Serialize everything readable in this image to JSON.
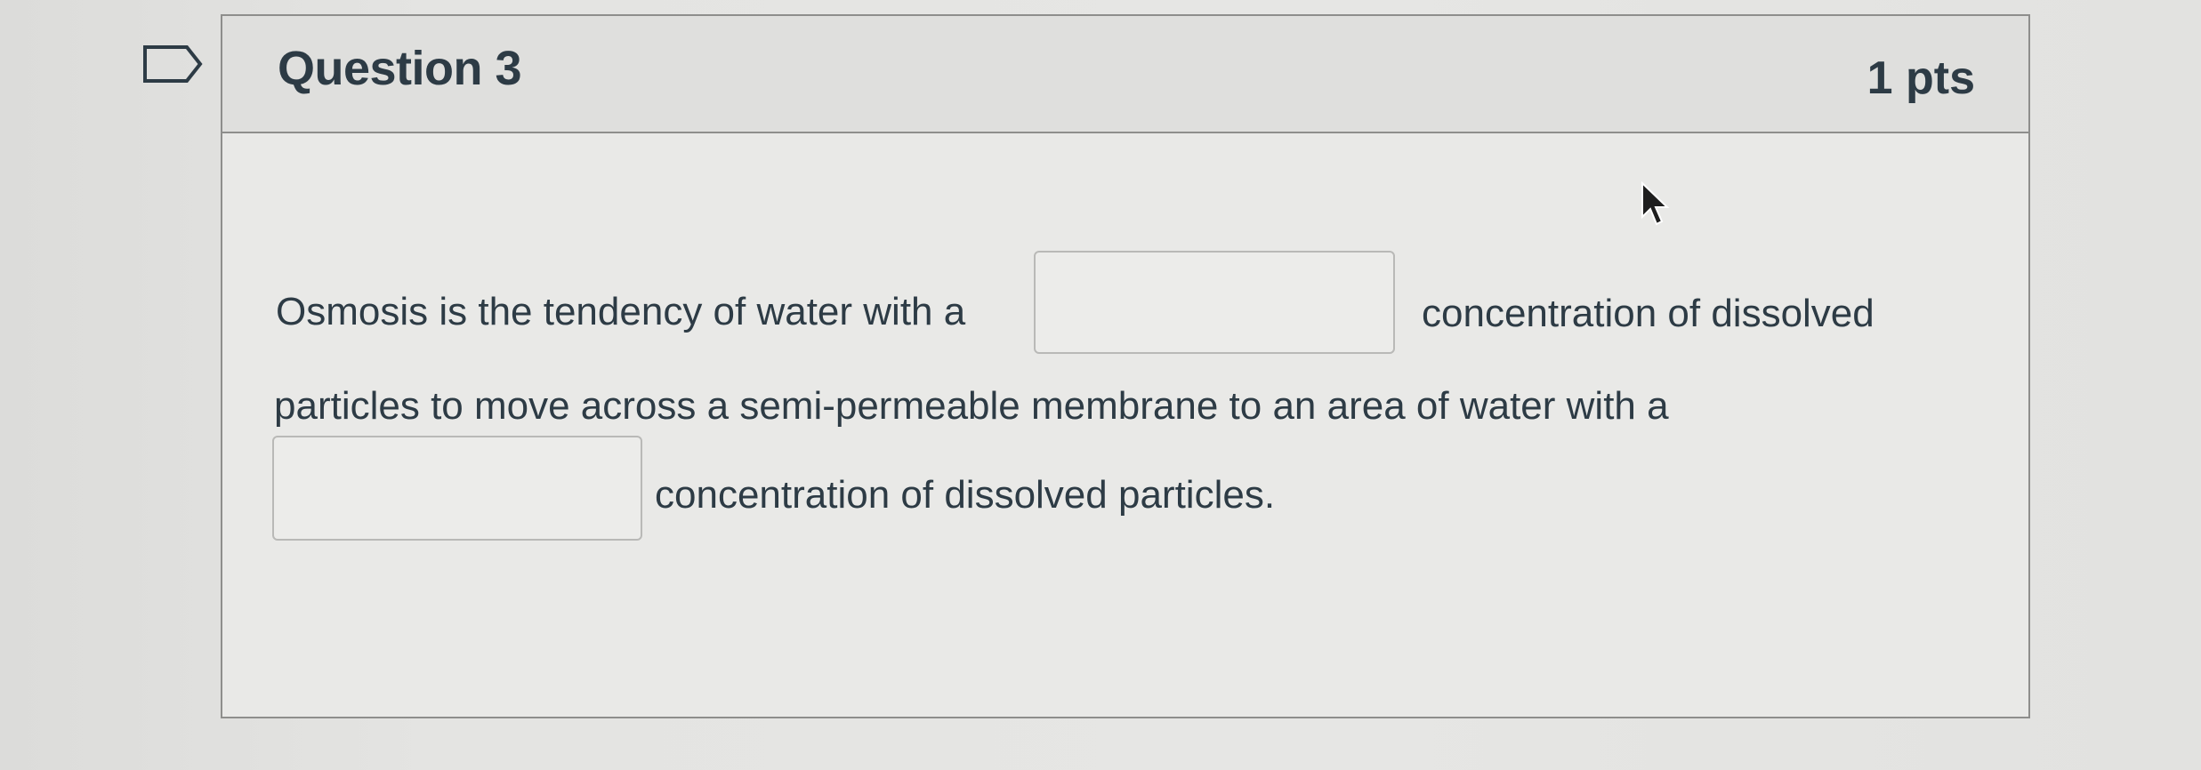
{
  "question": {
    "title": "Question 3",
    "points": "1 pts",
    "flag_icon": "flag-icon",
    "line1_start": "Osmosis is the tendency of water with a",
    "line1_end": "concentration of dissolved",
    "line2": "particles to move across a semi-permeable membrane to an area of water with a",
    "line3_end": "concentration of dissolved particles.",
    "blank1_value": "",
    "blank2_value": ""
  },
  "cursor_icon": "mouse-pointer-icon"
}
